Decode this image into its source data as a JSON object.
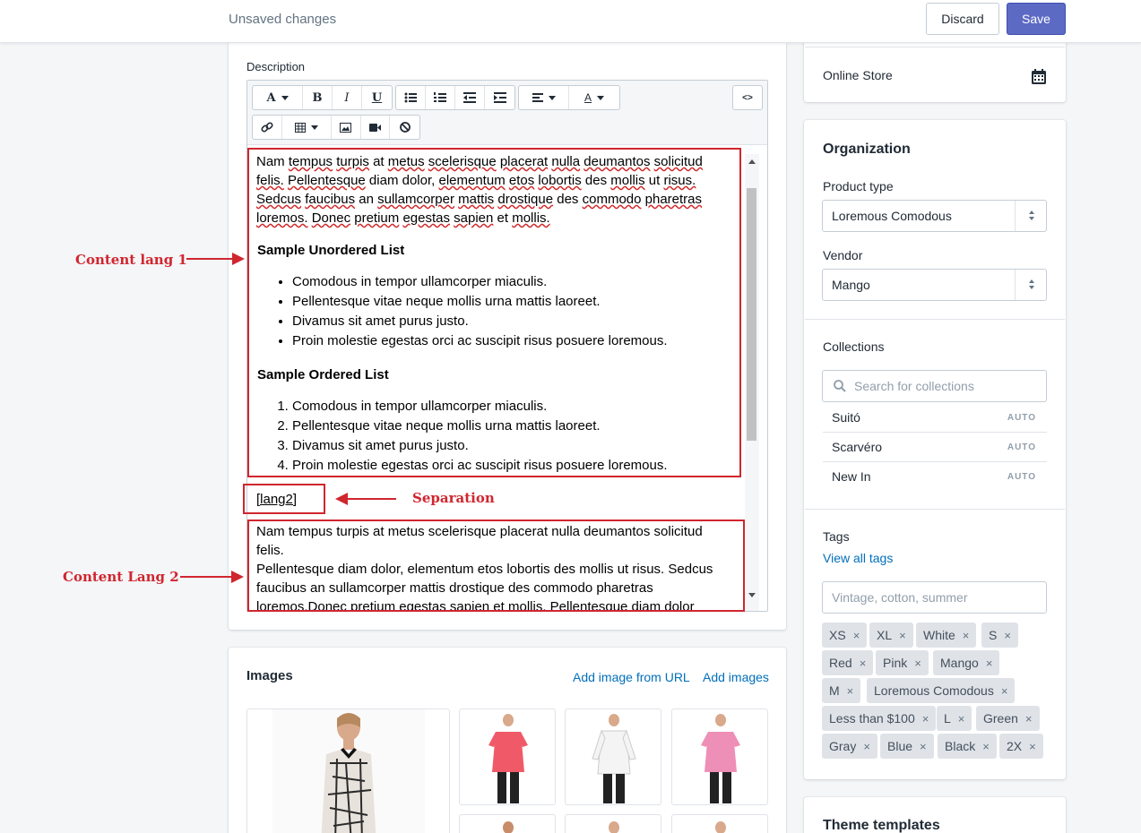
{
  "header": {
    "title": "Unsaved changes",
    "discard_label": "Discard",
    "save_label": "Save"
  },
  "description": {
    "label": "Description",
    "toolbar": {
      "font_icon": "A",
      "bold_icon": "B",
      "italic_icon": "I",
      "underline_icon": "U",
      "code_icon": "<>",
      "color_icon": "A"
    },
    "lang1": {
      "paragraph_words": [
        "Nam",
        "tempus",
        "turpis",
        "at",
        "metus",
        "scelerisque",
        "placerat",
        "nulla",
        "deumantos",
        "solicitud",
        "felis.",
        "Pellentesque",
        "diam",
        "dolor,",
        "elementum",
        "etos",
        "lobortis",
        "des",
        "mollis",
        "ut",
        "risus.",
        "Sedcus",
        "faucibus",
        "an",
        "sullamcorper",
        "mattis",
        "drostique",
        "des",
        "commodo",
        "pharetras",
        "loremos.",
        "Donec",
        "pretium",
        "egestas",
        "sapien",
        "et",
        "mollis."
      ],
      "unordered_heading": "Sample Unordered List",
      "unordered_items": [
        "Comodous in tempor ullamcorper miaculis.",
        "Pellentesque vitae neque mollis urna mattis laoreet.",
        "Divamus sit amet purus justo.",
        "Proin molestie egestas orci ac suscipit risus posuere loremous."
      ],
      "ordered_heading": "Sample Ordered List",
      "ordered_items": [
        "Comodous in tempor ullamcorper miaculis.",
        "Pellentesque vitae neque mollis urna mattis laoreet.",
        "Divamus sit amet purus justo.",
        "Proin molestie egestas orci ac suscipit risus posuere loremous."
      ]
    },
    "separator": "[lang2]",
    "lang2": {
      "paragraph_line1": "Nam tempus turpis at metus scelerisque placerat nulla deumantos solicitud felis.",
      "paragraph_line2": "Pellentesque diam dolor, elementum etos lobortis des mollis ut risus. Sedcus",
      "paragraph_line3": "faucibus an sullamcorper mattis drostique des commodo pharetras",
      "paragraph_line4": "loremos.Donec pretium egestas sapien et mollis. Pellentesque diam dolor"
    }
  },
  "annotations": {
    "content_lang1": "Content lang 1",
    "separation": "Separation",
    "content_lang2": "Content Lang 2",
    "color": "#d0262f"
  },
  "images": {
    "title": "Images",
    "add_from_url": "Add image from URL",
    "add_images": "Add images"
  },
  "sidebar": {
    "online_store": "Online Store",
    "organization_title": "Organization",
    "product_type_label": "Product type",
    "product_type_value": "Loremous Comodous",
    "vendor_label": "Vendor",
    "vendor_value": "Mango",
    "collections_label": "Collections",
    "collections_placeholder": "Search for collections",
    "collections": [
      {
        "name": "Suitó",
        "badge": "AUTO"
      },
      {
        "name": "Scarvéro",
        "badge": "AUTO"
      },
      {
        "name": "New In",
        "badge": "AUTO"
      }
    ],
    "tags_label": "Tags",
    "view_all_tags": "View all tags",
    "tags_placeholder": "Vintage, cotton, summer",
    "tags": [
      "XS",
      "XL",
      "White",
      "S",
      "Red",
      "Pink",
      "Mango",
      "M",
      "Loremous Comodous",
      "Less than $100",
      "L",
      "Green",
      "Gray",
      "Blue",
      "Black",
      "2X"
    ],
    "tag_remove_glyph": "×",
    "theme_templates_title": "Theme templates"
  },
  "colors": {
    "accent": "#5c6ac4",
    "link": "#006fbb",
    "annotation_red": "#d0262f",
    "background": "#f4f6f8"
  }
}
